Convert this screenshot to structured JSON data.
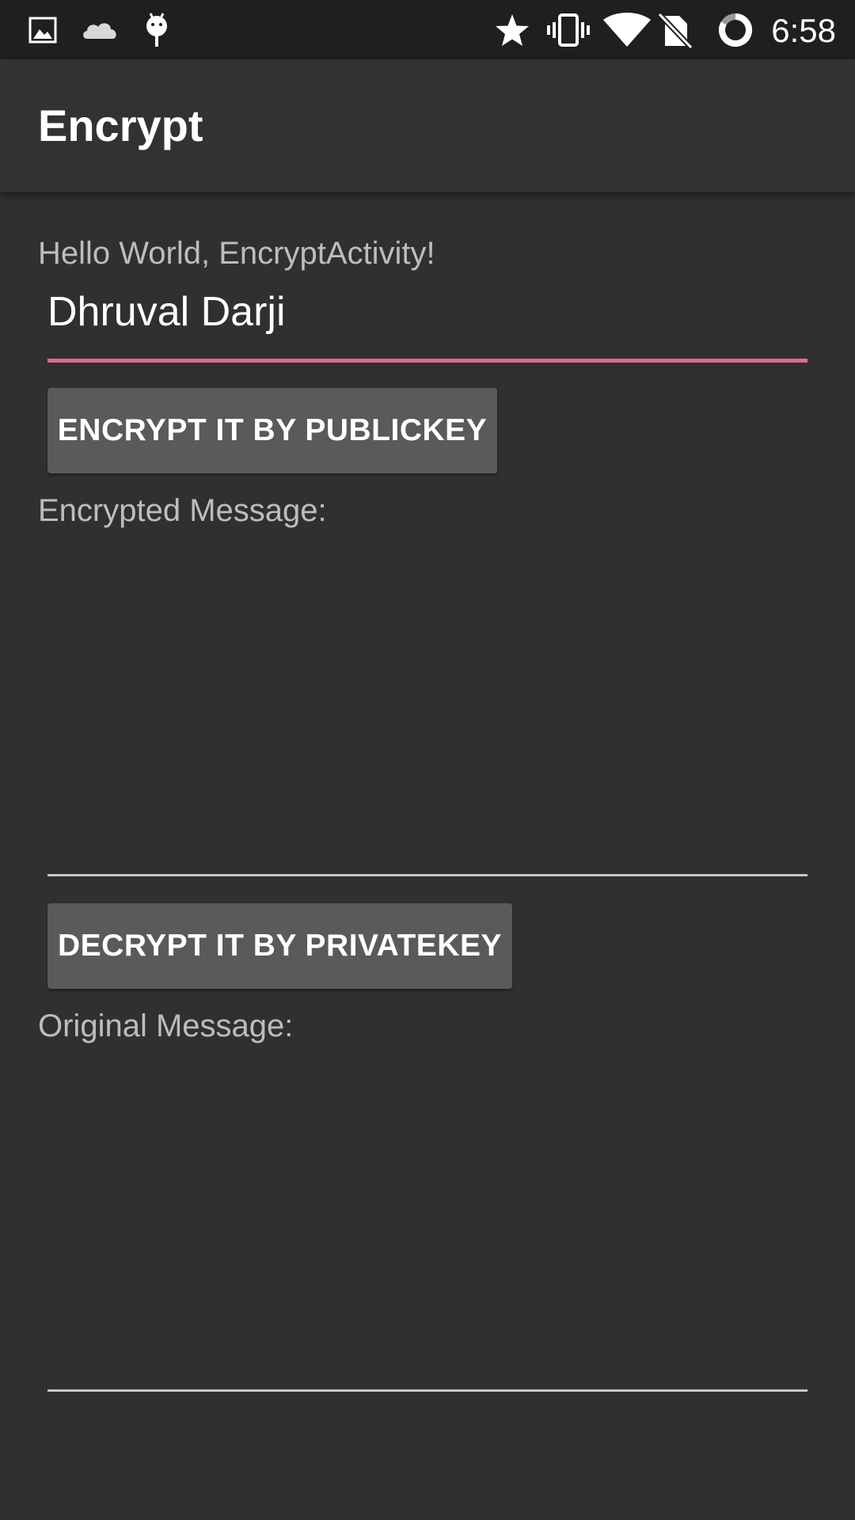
{
  "status_bar": {
    "time": "6:58",
    "left_icons": [
      "image-icon",
      "cloud-icon",
      "android-icon"
    ],
    "right_icons": [
      "star-icon",
      "vibrate-icon",
      "wifi-icon",
      "no-sim-icon",
      "battery-ring-icon"
    ]
  },
  "app_bar": {
    "title": "Encrypt"
  },
  "content": {
    "greeting": "Hello World, EncryptActivity!",
    "input_value": "Dhruval Darji",
    "encrypt_button": "ENCRYPT IT BY PUBLICKEY",
    "encrypted_label": "Encrypted Message:",
    "encrypted_value": "",
    "decrypt_button": "DECRYPT IT BY PRIVATEKEY",
    "original_label": "Original Message:",
    "original_value": ""
  },
  "colors": {
    "background": "#303030",
    "status_bar": "#1f1f1f",
    "app_bar": "#323232",
    "accent": "#e26a8c",
    "button": "#5a5a5c"
  }
}
